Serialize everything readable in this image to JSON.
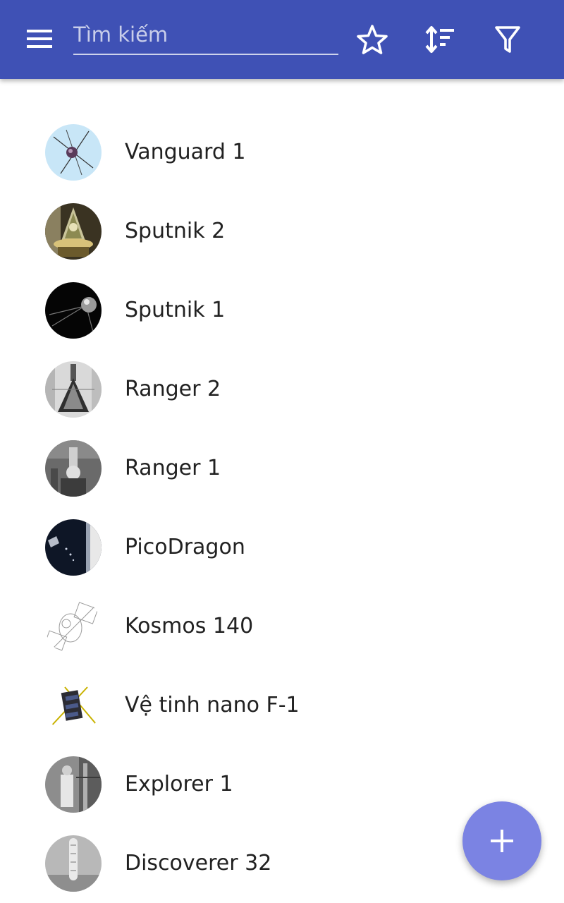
{
  "toolbar": {
    "background": "#3f51b5",
    "menu_icon": "hamburger-menu-icon",
    "search_placeholder": "Tìm kiếm",
    "search_value": "",
    "favorites_icon": "star-outline-icon",
    "sort_icon": "sort-icon",
    "filter_icon": "filter-icon"
  },
  "satellites": [
    {
      "name": "Vanguard 1"
    },
    {
      "name": "Sputnik 2"
    },
    {
      "name": "Sputnik 1"
    },
    {
      "name": "Ranger 2"
    },
    {
      "name": "Ranger 1"
    },
    {
      "name": "PicoDragon"
    },
    {
      "name": "Kosmos 140"
    },
    {
      "name": "Vệ tinh nano F-1"
    },
    {
      "name": "Explorer 1"
    },
    {
      "name": "Discoverer 32"
    }
  ],
  "fab": {
    "icon": "plus-icon",
    "color": "#7b83e3"
  }
}
